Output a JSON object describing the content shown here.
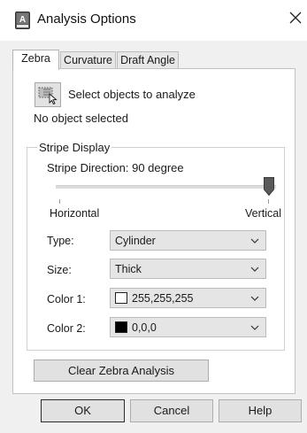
{
  "window": {
    "title": "Analysis Options",
    "icon": "autocad-app-icon",
    "close_icon": "close-icon"
  },
  "tabs": [
    {
      "label": "Zebra",
      "active": true
    },
    {
      "label": "Curvature",
      "active": false
    },
    {
      "label": "Draft Angle",
      "active": false
    }
  ],
  "selection": {
    "button_icon": "select-objects-icon",
    "label": "Select objects to analyze",
    "status": "No object selected"
  },
  "stripe_display": {
    "group_title": "Stripe Display",
    "direction_label": "Stripe Direction: 90 degree",
    "slider": {
      "value_fraction": 1.0,
      "min_label": "Horizontal",
      "max_label": "Vertical"
    },
    "type": {
      "label": "Type:",
      "value": "Cylinder"
    },
    "size": {
      "label": "Size:",
      "value": "Thick"
    },
    "color1": {
      "label": "Color 1:",
      "value": "255,255,255",
      "swatch": "#ffffff"
    },
    "color2": {
      "label": "Color 2:",
      "value": "0,0,0",
      "swatch": "#000000"
    }
  },
  "clear_button": "Clear Zebra Analysis",
  "footer": {
    "ok": "OK",
    "cancel": "Cancel",
    "help": "Help"
  }
}
